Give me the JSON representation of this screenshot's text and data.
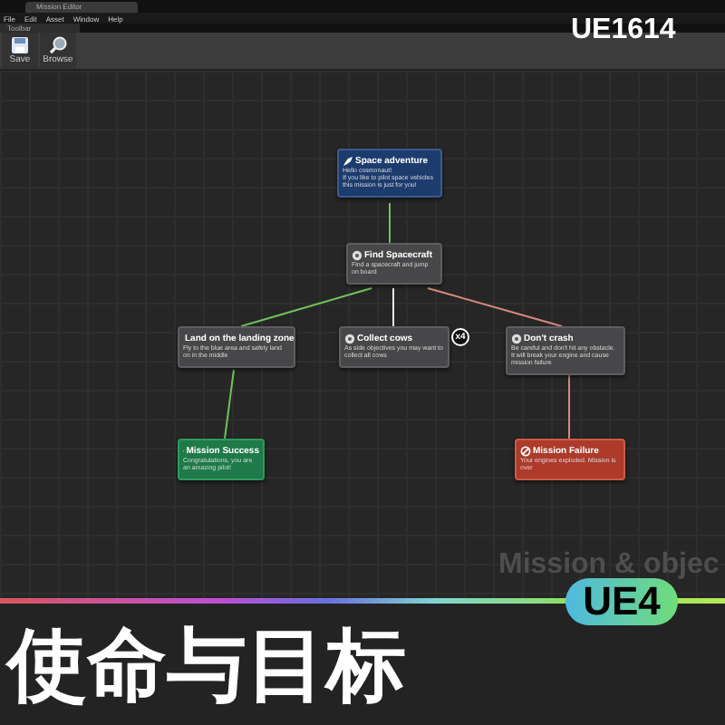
{
  "product_code": "UE1614",
  "editor_tab": "Mission Editor",
  "menu": [
    "File",
    "Edit",
    "Asset",
    "Window",
    "Help"
  ],
  "toolbar": {
    "title": "Toolbar",
    "buttons": [
      {
        "label": "Save",
        "kind": "save"
      },
      {
        "label": "Browse",
        "kind": "browse"
      }
    ]
  },
  "graph": {
    "watermark_text": "Mission & objec",
    "nodes": [
      {
        "kind": "start",
        "title": "Space adventure",
        "text": "Hello cosmonaut!\nIf you like to pilot space vehicles this mission is just for you!"
      },
      {
        "kind": "step",
        "title": "Find Spacecraft",
        "text": "Find a spacecraft and jump on board"
      },
      {
        "kind": "step",
        "title": "Land on the landing zone",
        "text": "Fly to the blue area and safely land on in the middle"
      },
      {
        "kind": "step",
        "title": "Collect cows",
        "text": "As side objectives you may want to collect all cows",
        "badge": "x4"
      },
      {
        "kind": "step",
        "title": "Don't crash",
        "text": "Be careful and don't hit any obstacle. It will break your engine and cause mission failure"
      },
      {
        "kind": "success",
        "title": "Mission Success",
        "text": "Congratulations, you are an amazing pilot!"
      },
      {
        "kind": "failure",
        "title": "Mission Failure",
        "text": "Your engines exploded. Mission is over"
      }
    ]
  },
  "banner": {
    "title": "使命与目标",
    "badge": "UE4"
  }
}
